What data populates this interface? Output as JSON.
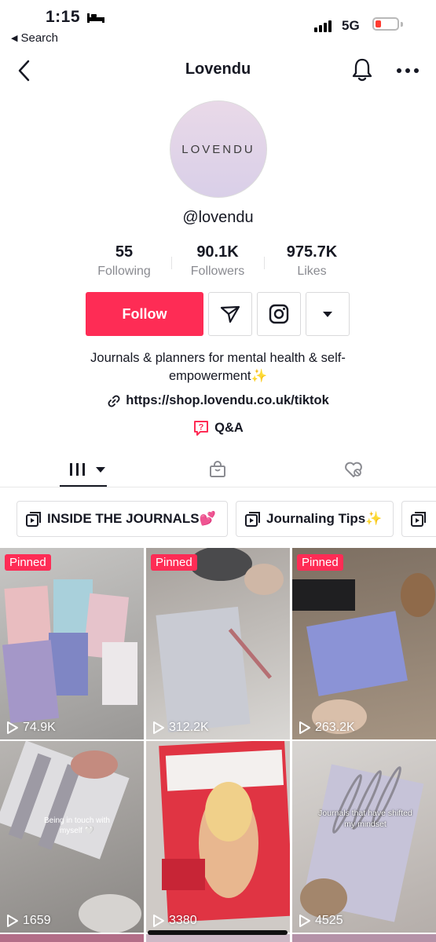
{
  "status_bar": {
    "time": "1:15",
    "back_app": "Search",
    "network": "5G"
  },
  "nav": {
    "title": "Lovendu"
  },
  "profile": {
    "avatar_text": "LOVENDU",
    "handle": "@lovendu",
    "stats": [
      {
        "value": "55",
        "label": "Following"
      },
      {
        "value": "90.1K",
        "label": "Followers"
      },
      {
        "value": "975.7K",
        "label": "Likes"
      }
    ],
    "follow_label": "Follow",
    "bio": "Journals & planners for mental health & self-empowerment✨",
    "link": "https://shop.lovendu.co.uk/tiktok",
    "qa_label": "Q&A"
  },
  "playlists": [
    {
      "label": "INSIDE THE JOURNALS💕"
    },
    {
      "label": "Journaling Tips✨"
    }
  ],
  "videos": [
    {
      "views": "74.9K",
      "pinned": "Pinned"
    },
    {
      "views": "312.2K",
      "pinned": "Pinned"
    },
    {
      "views": "263.2K",
      "pinned": "Pinned"
    },
    {
      "views": "1659",
      "overlay": "Being in touch with myself 🤍"
    },
    {
      "views": "3380",
      "overlay": ""
    },
    {
      "views": "4525",
      "overlay": "Journals that have shifted my mindset"
    }
  ],
  "colors": {
    "accent": "#fe2c55",
    "text": "#161823",
    "muted": "#8a8b91"
  }
}
